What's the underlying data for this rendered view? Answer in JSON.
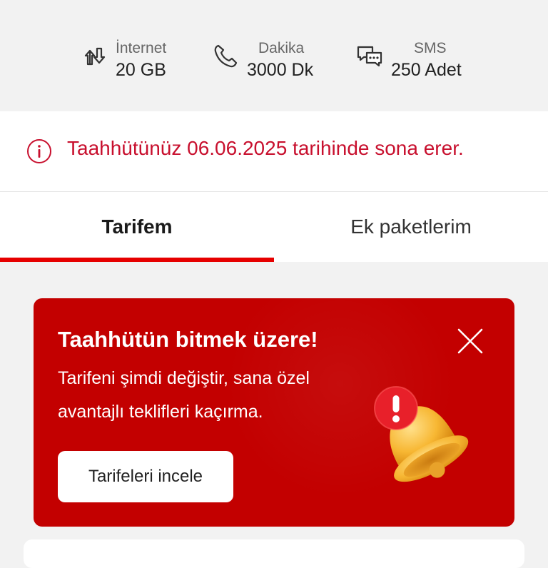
{
  "usage": {
    "internet": {
      "label": "İnternet",
      "value": "20 GB",
      "icon": "data-transfer-icon"
    },
    "minutes": {
      "label": "Dakika",
      "value": "3000 Dk",
      "icon": "phone-icon"
    },
    "sms": {
      "label": "SMS",
      "value": "250 Adet",
      "icon": "chat-bubbles-icon"
    }
  },
  "notice": {
    "icon": "info-icon",
    "message": "Taahhütünüz 06.06.2025 tarihinde sona erer.",
    "color": "#c8102e"
  },
  "tabs": [
    {
      "label": "Tarifem",
      "active": true
    },
    {
      "label": "Ek paketlerim",
      "active": false
    }
  ],
  "promo": {
    "title": "Taahhütün bitmek üzere!",
    "description_line1": "Tarifeni şimdi değiştir, sana özel",
    "description_line2": "avantajlı teklifleri kaçırma.",
    "button_label": "Tarifeleri incele",
    "close_icon": "close-icon",
    "illustration": "bell-alert-icon",
    "background_color": "#c30000"
  },
  "colors": {
    "brand_red": "#e60000",
    "background": "#f2f2f2"
  }
}
